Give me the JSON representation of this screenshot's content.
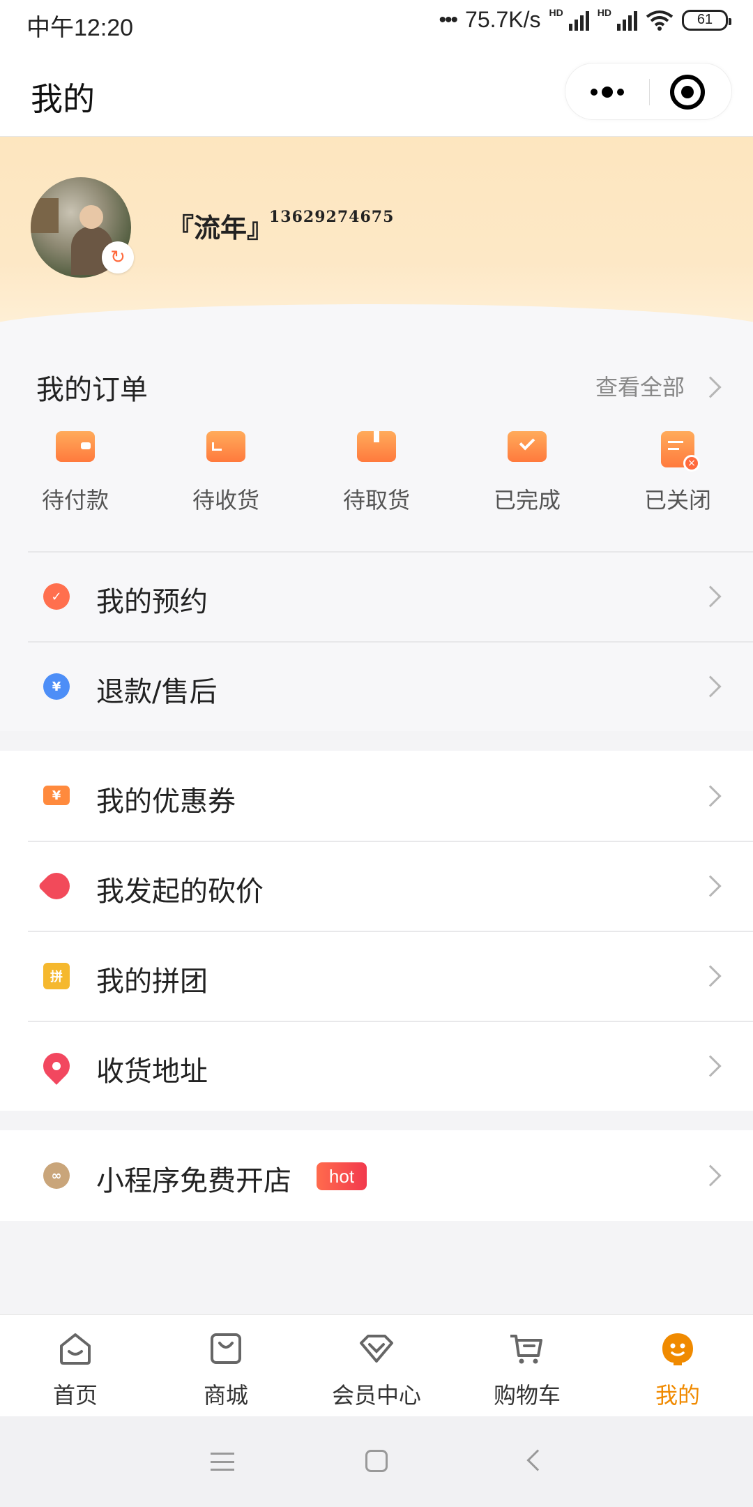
{
  "status_bar": {
    "time": "中午12:20",
    "network_speed": "75.7K/s",
    "signal_label": "HD",
    "battery": "61"
  },
  "nav": {
    "title": "我的",
    "more_icon": "more-dots-icon",
    "close_icon": "target-circle-icon"
  },
  "profile": {
    "nickname": "『流年』",
    "phone": "13629274675",
    "refresh_icon": "refresh-icon"
  },
  "orders": {
    "title": "我的订单",
    "view_all": "查看全部",
    "items": [
      {
        "label": "待付款",
        "icon": "wallet-icon"
      },
      {
        "label": "待收货",
        "icon": "truck-icon"
      },
      {
        "label": "待取货",
        "icon": "box-icon"
      },
      {
        "label": "已完成",
        "icon": "clipboard-check-icon"
      },
      {
        "label": "已关闭",
        "icon": "document-close-icon"
      }
    ]
  },
  "menu_group_1": [
    {
      "label": "我的预约",
      "icon": "check-circle-icon",
      "color": "#ff6f4e"
    },
    {
      "label": "退款/售后",
      "icon": "yuan-refund-icon",
      "color": "#4d8ef7"
    }
  ],
  "menu_group_2": [
    {
      "label": "我的优惠券",
      "icon": "coupon-icon",
      "color": "#ff8a3d"
    },
    {
      "label": "我发起的砍价",
      "icon": "price-tag-icon",
      "color": "#f24a5a"
    },
    {
      "label": "我的拼团",
      "icon": "group-buy-icon",
      "glyph": "拼",
      "color": "#f5b82e"
    },
    {
      "label": "收货地址",
      "icon": "location-pin-icon",
      "color": "#f2475f"
    }
  ],
  "menu_group_3": [
    {
      "label": "小程序免费开店",
      "icon": "link-icon",
      "color": "#c9a57a",
      "badge": "hot"
    }
  ],
  "tabbar": [
    {
      "label": "首页",
      "icon": "home-icon"
    },
    {
      "label": "商城",
      "icon": "shopping-bag-icon"
    },
    {
      "label": "会员中心",
      "icon": "diamond-icon"
    },
    {
      "label": "购物车",
      "icon": "cart-icon"
    },
    {
      "label": "我的",
      "icon": "user-face-icon",
      "active": true
    }
  ],
  "colors": {
    "accent": "#f08a00",
    "header_bg": "#fde6bf",
    "order_icon": "#ff8a3d"
  }
}
